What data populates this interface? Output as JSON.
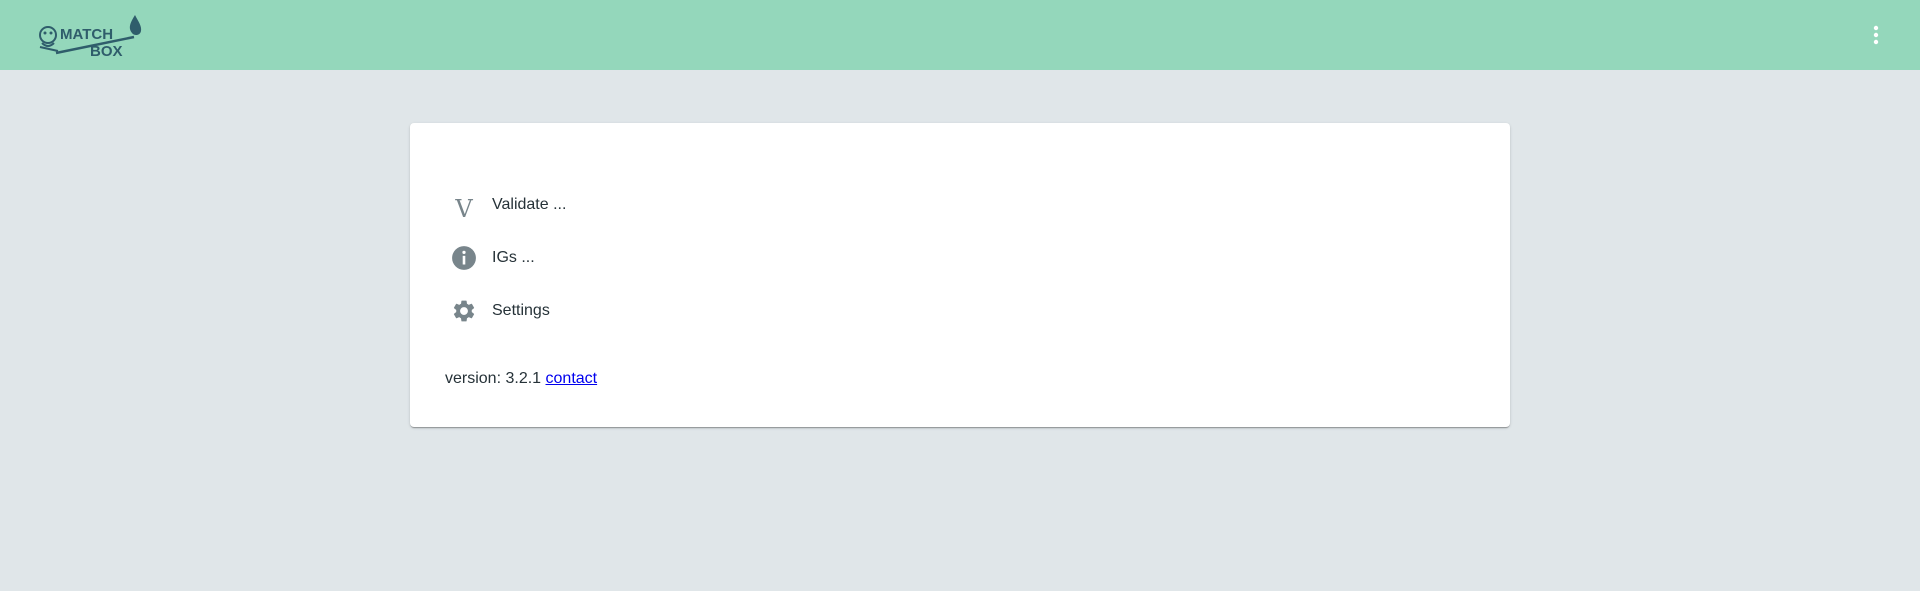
{
  "header": {
    "logo_text_line1": "MATCH",
    "logo_text_line2": "BOX",
    "menu_icon": "more-vert-icon",
    "background_color": "#94d7bb"
  },
  "nav": {
    "items": [
      {
        "icon": "v-letter-icon",
        "glyph": "V",
        "label": "Validate ..."
      },
      {
        "icon": "info-icon",
        "label": "IGs ..."
      },
      {
        "icon": "gear-icon",
        "label": "Settings"
      }
    ]
  },
  "footer": {
    "version_prefix": "version: 3.2.1",
    "contact_link": "contact"
  },
  "colors": {
    "page_background": "#e0e6e9",
    "icon": "#78858b",
    "link": "#0000ee"
  }
}
